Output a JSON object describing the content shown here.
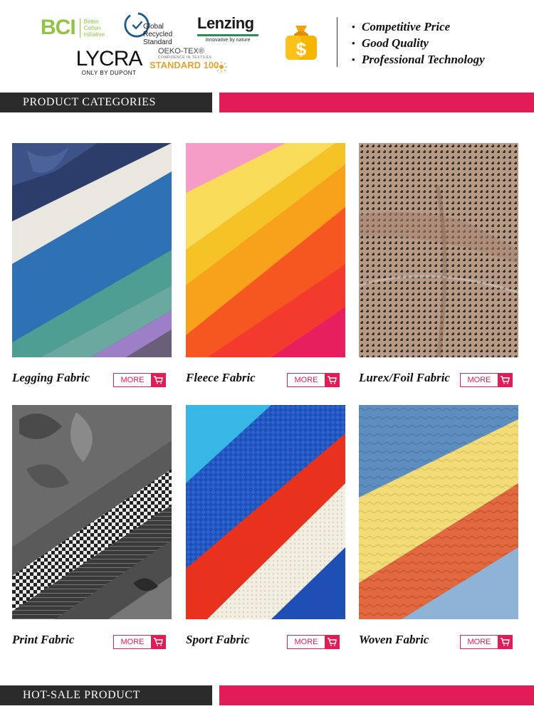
{
  "header": {
    "certifications": {
      "bci": {
        "mark": "BCI",
        "text": [
          "Better",
          "Cotton",
          "Initiative"
        ]
      },
      "grs": {
        "text": [
          "Global Recycled",
          "Standard"
        ]
      },
      "lenzing": {
        "name": "Lenzing",
        "tagline": "Innovative by nature"
      },
      "lycra": {
        "name": "LYCRA",
        "sub": "ONLY BY DUPONT"
      },
      "oeko": {
        "top": "OEKO-TEX®",
        "middle": "CONFIDENCE IN TEXTILES",
        "standard": "STANDARD 100"
      }
    },
    "price_icon": "dollar-bag-icon",
    "slogans": [
      "Competitive Price",
      "Good Quality",
      "Professional Technology"
    ]
  },
  "sections": {
    "categories_title": "PRODUCT CATEGORIES",
    "hot_sale_title": "HOT-SALE PRODUCT"
  },
  "categories": [
    {
      "name": "Legging Fabric",
      "more": "MORE"
    },
    {
      "name": "Fleece Fabric",
      "more": "MORE"
    },
    {
      "name": "Lurex/Foil Fabric",
      "more": "MORE"
    },
    {
      "name": "Print Fabric",
      "more": "MORE"
    },
    {
      "name": "Sport Fabric",
      "more": "MORE"
    },
    {
      "name": "Woven Fabric",
      "more": "MORE"
    }
  ],
  "colors": {
    "accent": "#e21c57",
    "bar_dark": "#2b2b2b",
    "bci_green": "#8dc63f",
    "oeko_orange": "#e9a22b"
  }
}
